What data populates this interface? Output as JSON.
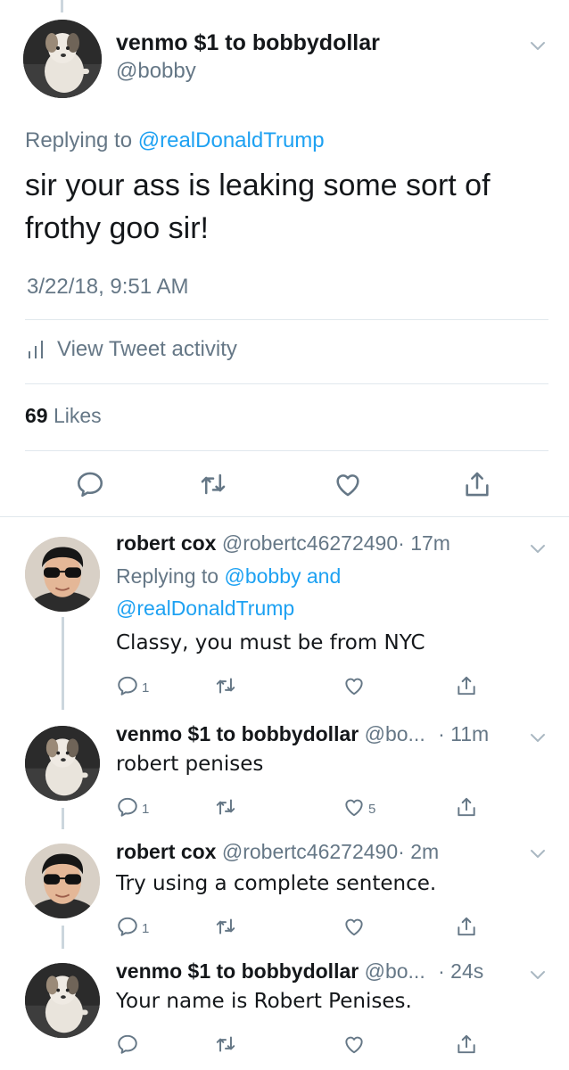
{
  "main_tweet": {
    "display_name": "venmo $1 to bobbydollar",
    "handle": "@bobby",
    "replying_prefix": "Replying to",
    "replying_to": "@realDonaldTrump",
    "text_line1": "sir your ass is leaking some sort of",
    "text_line2": "frothy goo sir!",
    "timestamp": "3/22/18, 9:51 AM",
    "activity_label": "View Tweet activity",
    "like_count": "69",
    "likes_label": "Likes",
    "icons": [
      "reply-icon",
      "retweet-icon",
      "like-icon",
      "share-icon"
    ]
  },
  "replies": [
    {
      "display_name": "robert cox",
      "handle": "@robertc46272490",
      "time": "· 17m",
      "replying_prefix": "Replying to",
      "replying_to_1": "@bobby",
      "replying_and": "and",
      "replying_to_2": "@realDonaldTrump",
      "text": "Classy, you must be from NYC",
      "reply_count": "1",
      "retweet_count": "",
      "like_count": ""
    },
    {
      "display_name": "venmo $1 to bobbydollar",
      "handle": "@bo...",
      "time": "· 11m",
      "text": "robert penises",
      "reply_count": "1",
      "retweet_count": "",
      "like_count": "5"
    },
    {
      "display_name": "robert cox",
      "handle": "@robertc46272490",
      "time": "· 2m",
      "text": "Try using a complete sentence.",
      "reply_count": "1",
      "retweet_count": "",
      "like_count": ""
    },
    {
      "display_name": "venmo $1 to bobbydollar",
      "handle": "@bo...",
      "time": "· 24s",
      "text": "Your name is Robert Penises.",
      "reply_count": "",
      "retweet_count": "",
      "like_count": ""
    }
  ],
  "colors": {
    "accent": "#1da1f2",
    "secondary_text": "#657786",
    "primary_text": "#14171a",
    "divider": "#e1e8ed",
    "thread_line": "#ccd6dd"
  }
}
